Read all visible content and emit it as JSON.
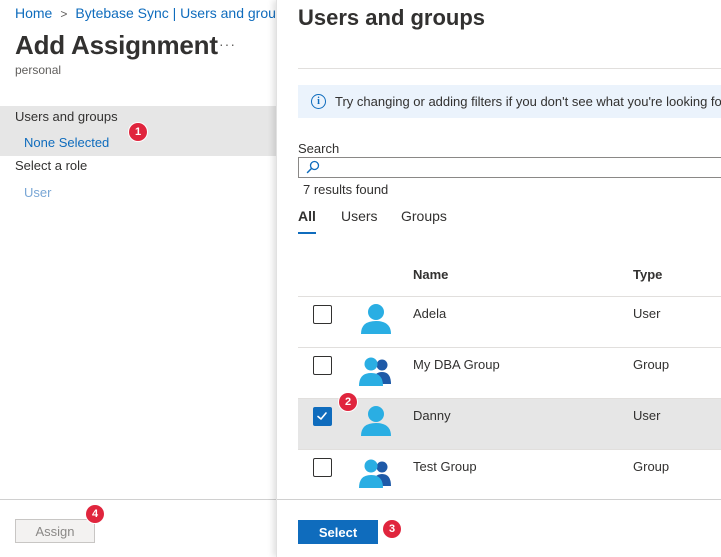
{
  "breadcrumb": {
    "home": "Home",
    "separator": ">",
    "current": "Bytebase Sync | Users and groups"
  },
  "assignment": {
    "title": "Add Assignment",
    "more_label": "···",
    "subtitle": "personal",
    "users_groups_label": "Users and groups",
    "users_groups_value": "None Selected",
    "role_label": "Select a role",
    "role_value": "User",
    "assign_label": "Assign"
  },
  "blade": {
    "title": "Users and groups",
    "info_icon_glyph": "i",
    "info_text": "Try changing or adding filters if you don't see what you're looking for.",
    "search_label": "Search",
    "search_value": "",
    "results_count": "7 results found",
    "tabs": [
      {
        "label": "All",
        "active": true
      },
      {
        "label": "Users",
        "active": false
      },
      {
        "label": "Groups",
        "active": false
      }
    ],
    "columns": {
      "name": "Name",
      "type": "Type"
    },
    "rows": [
      {
        "name": "Adela",
        "type": "User",
        "checked": false,
        "icon": "user-icon"
      },
      {
        "name": "My DBA Group",
        "type": "Group",
        "checked": false,
        "icon": "group-icon"
      },
      {
        "name": "Danny",
        "type": "User",
        "checked": true,
        "icon": "user-icon"
      },
      {
        "name": "Test Group",
        "type": "Group",
        "checked": false,
        "icon": "group-icon"
      }
    ],
    "select_label": "Select"
  },
  "annotations": [
    "1",
    "2",
    "3",
    "4"
  ],
  "colors": {
    "accent": "#0f6cbd",
    "badge": "#e0253d",
    "selected_row": "#e6e6e6",
    "info_bg": "#ebf3fc"
  }
}
